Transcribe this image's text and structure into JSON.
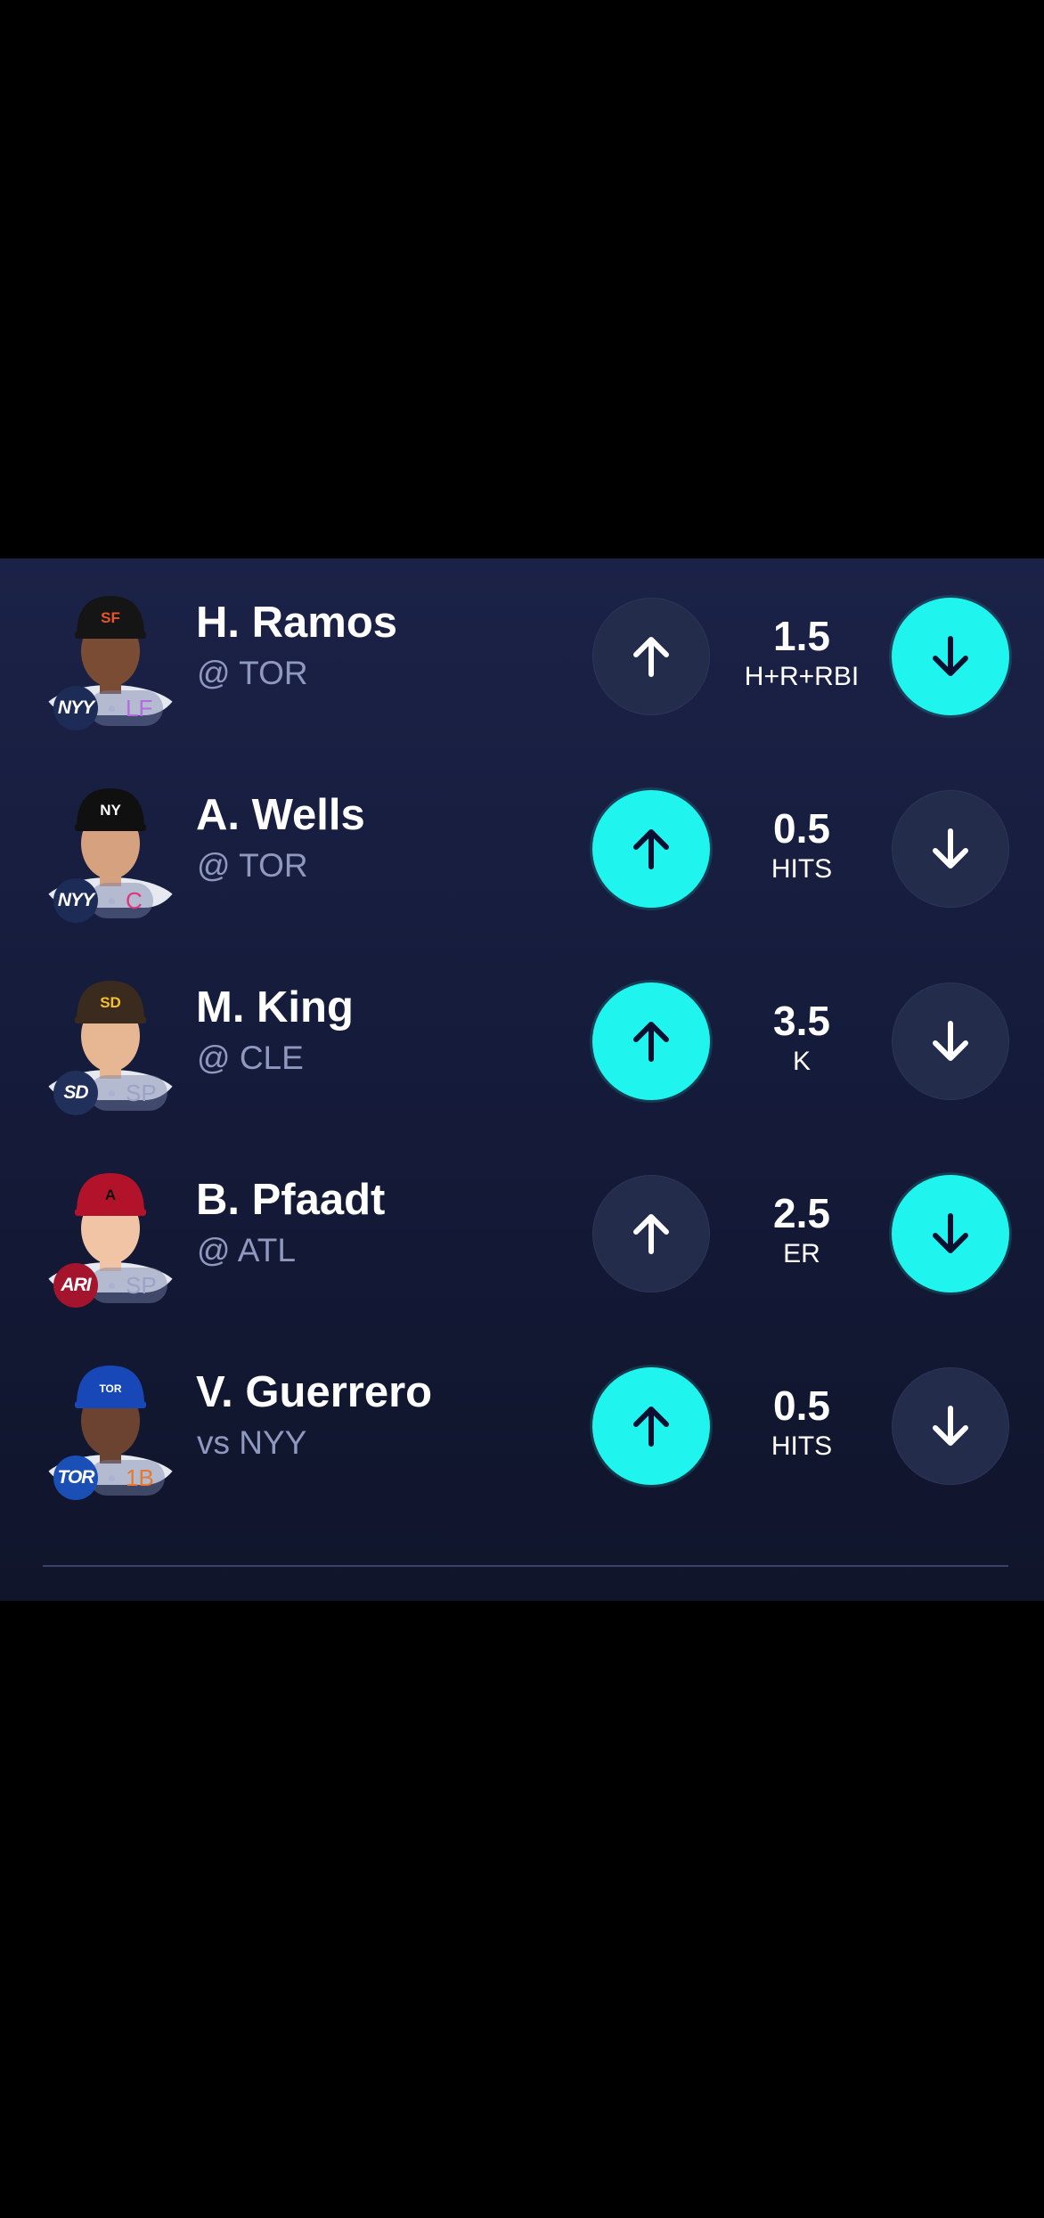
{
  "players": [
    {
      "name": "H. Ramos",
      "opponent": "@ TOR",
      "team": "NYY",
      "position": "LF",
      "line": "1.5",
      "stat": "H+R+RBI",
      "up_selected": false,
      "down_selected": true,
      "team_color": "#1d2c57",
      "pos_color": "#b46be0",
      "hat_color": "#151515",
      "hat_logo": "SF",
      "hat_logo_color": "#e8552a",
      "skin": "#7a4c34"
    },
    {
      "name": "A. Wells",
      "opponent": "@ TOR",
      "team": "NYY",
      "position": "C",
      "line": "0.5",
      "stat": "HITS",
      "up_selected": true,
      "down_selected": false,
      "team_color": "#1d2c57",
      "pos_color": "#e0347f",
      "hat_color": "#101010",
      "hat_logo": "NY",
      "hat_logo_color": "#ffffff",
      "skin": "#d6a17e"
    },
    {
      "name": "M. King",
      "opponent": "@ CLE",
      "team": "SD",
      "position": "SP",
      "line": "3.5",
      "stat": "K",
      "up_selected": true,
      "down_selected": false,
      "team_color": "#20305a",
      "pos_color": "#9aa3c7",
      "hat_color": "#3b2a1e",
      "hat_logo": "SD",
      "hat_logo_color": "#f2c230",
      "skin": "#e7b692"
    },
    {
      "name": "B. Pfaadt",
      "opponent": "@ ATL",
      "team": "ARI",
      "position": "SP",
      "line": "2.5",
      "stat": "ER",
      "up_selected": false,
      "down_selected": true,
      "team_color": "#a4142c",
      "pos_color": "#9aa3c7",
      "hat_color": "#b3122b",
      "hat_logo": "A",
      "hat_logo_color": "#111111",
      "skin": "#f1c4a6"
    },
    {
      "name": "V. Guerrero",
      "opponent": "vs NYY",
      "team": "TOR",
      "position": "1B",
      "line": "0.5",
      "stat": "HITS",
      "up_selected": true,
      "down_selected": false,
      "team_color": "#1a4fb5",
      "pos_color": "#e8782e",
      "hat_color": "#1848b8",
      "hat_logo": "TOR",
      "hat_logo_color": "#ffffff",
      "skin": "#6b4330"
    }
  ],
  "icons": {
    "up": "arrow-up-icon",
    "down": "arrow-down-icon"
  },
  "colors": {
    "accent": "#1ff5ee",
    "panel": "#1b2247",
    "button": "#242c4c"
  }
}
